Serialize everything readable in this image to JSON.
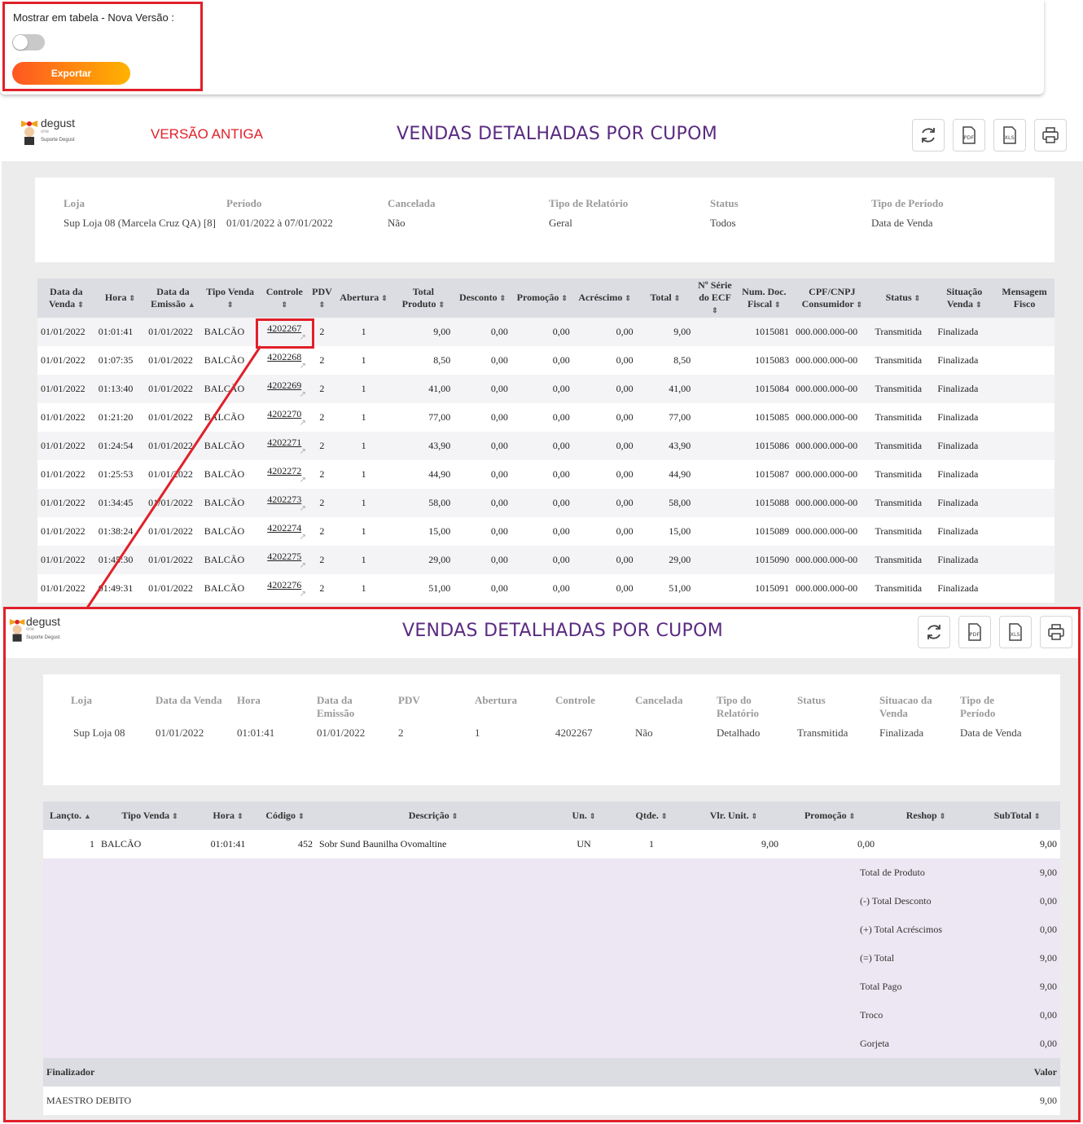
{
  "filter": {
    "toggle_label": "Mostrar em tabela - Nova Versão :",
    "toggle_state": "off",
    "export_label": "Exportar"
  },
  "logo": {
    "name": "degust",
    "sub": "one",
    "caption": "Suporte Degust"
  },
  "old_version": {
    "banner": "VERSÃO ANTIGA",
    "title": "VENDAS DETALHADAS POR CUPOM",
    "filters": [
      {
        "label": "Loja",
        "value": "Sup Loja 08 (Marcela Cruz QA) [8]"
      },
      {
        "label": "Período",
        "value": "01/01/2022 à 07/01/2022"
      },
      {
        "label": "Cancelada",
        "value": "Não"
      },
      {
        "label": "Tipo de Relatório",
        "value": "Geral"
      },
      {
        "label": "Status",
        "value": "Todos"
      },
      {
        "label": "Tipo de Período",
        "value": "Data de Venda"
      }
    ],
    "columns": [
      {
        "label": "Data da Venda",
        "sort": "⇕"
      },
      {
        "label": "Hora",
        "sort": "⇕"
      },
      {
        "label": "Data da Emissão",
        "sort": "▲"
      },
      {
        "label": "Tipo Venda",
        "sort": "⇕"
      },
      {
        "label": "Controle",
        "sort": "⇕"
      },
      {
        "label": "PDV",
        "sort": "⇕"
      },
      {
        "label": "Abertura",
        "sort": "⇕"
      },
      {
        "label": "Total Produto",
        "sort": "⇕"
      },
      {
        "label": "Desconto",
        "sort": "⇕"
      },
      {
        "label": "Promoção",
        "sort": "⇕"
      },
      {
        "label": "Acréscimo",
        "sort": "⇕"
      },
      {
        "label": "Total",
        "sort": "⇕"
      },
      {
        "label": "Nº Série do ECF",
        "sort": "⇕"
      },
      {
        "label": "Num. Doc. Fiscal",
        "sort": "⇕"
      },
      {
        "label": "CPF/CNPJ Consumidor",
        "sort": "⇕"
      },
      {
        "label": "Status",
        "sort": "⇕"
      },
      {
        "label": "Situação Venda",
        "sort": "⇕"
      },
      {
        "label": "Mensagem Fisco",
        "sort": ""
      }
    ],
    "rows": [
      [
        "01/01/2022",
        "01:01:41",
        "01/01/2022",
        "BALCÃO",
        "4202267",
        "2",
        "1",
        "9,00",
        "0,00",
        "0,00",
        "0,00",
        "9,00",
        "",
        "1015081",
        "000.000.000-00",
        "Transmitida",
        "Finalizada",
        ""
      ],
      [
        "01/01/2022",
        "01:07:35",
        "01/01/2022",
        "BALCÃO",
        "4202268",
        "2",
        "1",
        "8,50",
        "0,00",
        "0,00",
        "0,00",
        "8,50",
        "",
        "1015083",
        "000.000.000-00",
        "Transmitida",
        "Finalizada",
        ""
      ],
      [
        "01/01/2022",
        "01:13:40",
        "01/01/2022",
        "BALCÃO",
        "4202269",
        "2",
        "1",
        "41,00",
        "0,00",
        "0,00",
        "0,00",
        "41,00",
        "",
        "1015084",
        "000.000.000-00",
        "Transmitida",
        "Finalizada",
        ""
      ],
      [
        "01/01/2022",
        "01:21:20",
        "01/01/2022",
        "BALCÃO",
        "4202270",
        "2",
        "1",
        "77,00",
        "0,00",
        "0,00",
        "0,00",
        "77,00",
        "",
        "1015085",
        "000.000.000-00",
        "Transmitida",
        "Finalizada",
        ""
      ],
      [
        "01/01/2022",
        "01:24:54",
        "01/01/2022",
        "BALCÃO",
        "4202271",
        "2",
        "1",
        "43,90",
        "0,00",
        "0,00",
        "0,00",
        "43,90",
        "",
        "1015086",
        "000.000.000-00",
        "Transmitida",
        "Finalizada",
        ""
      ],
      [
        "01/01/2022",
        "01:25:53",
        "01/01/2022",
        "BALCÃO",
        "4202272",
        "2",
        "1",
        "44,90",
        "0,00",
        "0,00",
        "0,00",
        "44,90",
        "",
        "1015087",
        "000.000.000-00",
        "Transmitida",
        "Finalizada",
        ""
      ],
      [
        "01/01/2022",
        "01:34:45",
        "01/01/2022",
        "BALCÃO",
        "4202273",
        "2",
        "1",
        "58,00",
        "0,00",
        "0,00",
        "0,00",
        "58,00",
        "",
        "1015088",
        "000.000.000-00",
        "Transmitida",
        "Finalizada",
        ""
      ],
      [
        "01/01/2022",
        "01:38:24",
        "01/01/2022",
        "BALCÃO",
        "4202274",
        "2",
        "1",
        "15,00",
        "0,00",
        "0,00",
        "0,00",
        "15,00",
        "",
        "1015089",
        "000.000.000-00",
        "Transmitida",
        "Finalizada",
        ""
      ],
      [
        "01/01/2022",
        "01:45:30",
        "01/01/2022",
        "BALCÃO",
        "4202275",
        "2",
        "1",
        "29,00",
        "0,00",
        "0,00",
        "0,00",
        "29,00",
        "",
        "1015090",
        "000.000.000-00",
        "Transmitida",
        "Finalizada",
        ""
      ],
      [
        "01/01/2022",
        "01:49:31",
        "01/01/2022",
        "BALCÃO",
        "4202276",
        "2",
        "1",
        "51,00",
        "0,00",
        "0,00",
        "0,00",
        "51,00",
        "",
        "1015091",
        "000.000.000-00",
        "Transmitida",
        "Finalizada",
        ""
      ]
    ]
  },
  "new_version": {
    "title": "VENDAS DETALHADAS POR CUPOM",
    "fields": [
      {
        "label": "Loja",
        "value": "Sup Loja 08"
      },
      {
        "label": "Data da Venda",
        "value": "01/01/2022"
      },
      {
        "label": "Hora",
        "value": "01:01:41"
      },
      {
        "label": "Data da Emissão",
        "value": "01/01/2022"
      },
      {
        "label": "PDV",
        "value": "2"
      },
      {
        "label": "Abertura",
        "value": "1"
      },
      {
        "label": "Controle",
        "value": "4202267"
      },
      {
        "label": "Cancelada",
        "value": "Não"
      },
      {
        "label": "Tipo do Relatório",
        "value": "Detalhado"
      },
      {
        "label": "Status",
        "value": "Transmitida"
      },
      {
        "label": "Situacao da Venda",
        "value": "Finalizada"
      },
      {
        "label": "Tipo de Período",
        "value": "Data de Venda"
      }
    ],
    "columns": [
      {
        "label": "Lançto.",
        "sort": "▲"
      },
      {
        "label": "Tipo Venda",
        "sort": "⇕"
      },
      {
        "label": "Hora",
        "sort": "⇕"
      },
      {
        "label": "Código",
        "sort": "⇕"
      },
      {
        "label": "Descrição",
        "sort": "⇕"
      },
      {
        "label": "Un.",
        "sort": "⇕"
      },
      {
        "label": "Qtde.",
        "sort": "⇕"
      },
      {
        "label": "Vlr. Unit.",
        "sort": "⇕"
      },
      {
        "label": "Promoção",
        "sort": "⇕"
      },
      {
        "label": "Reshop",
        "sort": "⇕"
      },
      {
        "label": "SubTotal",
        "sort": "⇕"
      }
    ],
    "item": [
      "1",
      "BALCÃO",
      "01:01:41",
      "452",
      "Sobr Sund Baunilha Ovomaltine",
      "UN",
      "1",
      "9,00",
      "0,00",
      "",
      "9,00"
    ],
    "totals": [
      {
        "label": "Total de Produto",
        "value": "9,00"
      },
      {
        "label": "(-) Total Desconto",
        "value": "0,00"
      },
      {
        "label": "(+) Total Acréscimos",
        "value": "0,00"
      },
      {
        "label": "(=) Total",
        "value": "9,00"
      },
      {
        "label": "Total Pago",
        "value": "9,00"
      },
      {
        "label": "Troco",
        "value": "0,00"
      },
      {
        "label": "Gorjeta",
        "value": "0,00"
      }
    ],
    "finalizer": {
      "head_label": "Finalizador",
      "head_value": "Valor",
      "name": "MAESTRO DEBITO",
      "value": "9,00"
    }
  },
  "colors": {
    "accent": "#5a2a80",
    "highlight": "#e0202a",
    "export_from": "#ff5722",
    "export_to": "#ffb300"
  }
}
